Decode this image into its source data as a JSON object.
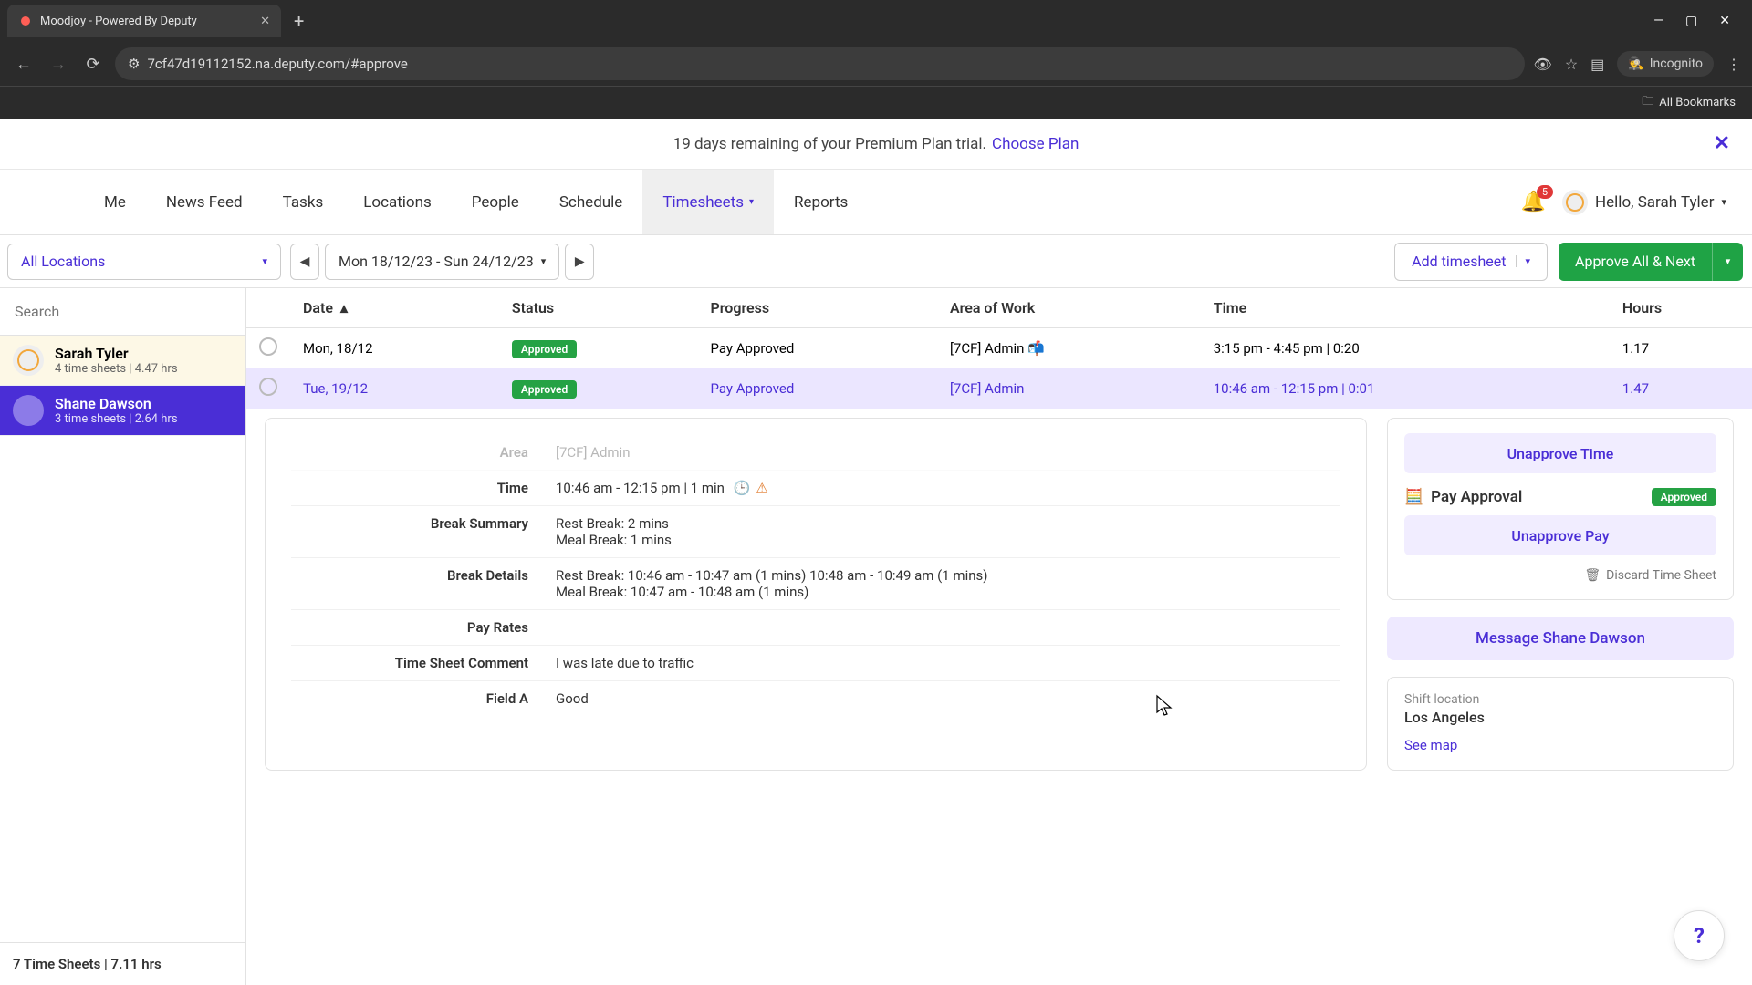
{
  "browser": {
    "tab_title": "Moodjoy - Powered By Deputy",
    "url": "7cf47d19112152.na.deputy.com/#approve",
    "incognito_label": "Incognito",
    "all_bookmarks": "All Bookmarks"
  },
  "banner": {
    "text": "19 days remaining of your Premium Plan trial.",
    "link": "Choose Plan"
  },
  "nav": {
    "items": [
      "Me",
      "News Feed",
      "Tasks",
      "Locations",
      "People",
      "Schedule",
      "Timesheets",
      "Reports"
    ],
    "active_index": 6,
    "notification_count": "5",
    "greeting": "Hello, Sarah Tyler"
  },
  "toolbar": {
    "location_filter": "All Locations",
    "date_range": "Mon 18/12/23 - Sun 24/12/23",
    "add_timesheet": "Add timesheet",
    "approve_all": "Approve All & Next"
  },
  "sidebar": {
    "search_placeholder": "Search",
    "employees": [
      {
        "name": "Sarah Tyler",
        "sub": "4 time sheets | 4.47 hrs",
        "selected": false
      },
      {
        "name": "Shane Dawson",
        "sub": "3 time sheets | 2.64 hrs",
        "selected": true
      }
    ],
    "footer": "7 Time Sheets | 7.11 hrs"
  },
  "table": {
    "headers": {
      "date": "Date",
      "status": "Status",
      "progress": "Progress",
      "area": "Area of Work",
      "time": "Time",
      "hours": "Hours"
    },
    "rows": [
      {
        "date": "Mon, 18/12",
        "status": "Approved",
        "progress": "Pay Approved",
        "area": "[7CF] Admin 📬",
        "time": "3:15 pm - 4:45 pm | 0:20",
        "hours": "1.17",
        "selected": false
      },
      {
        "date": "Tue, 19/12",
        "status": "Approved",
        "progress": "Pay Approved",
        "area": "[7CF] Admin",
        "time": "10:46 am - 12:15 pm | 0:01",
        "hours": "1.47",
        "selected": true
      }
    ]
  },
  "detail": {
    "area_label": "Area",
    "area_value": "[7CF] Admin",
    "time_label": "Time",
    "time_value": "10:46 am - 12:15 pm | 1 min",
    "break_summary_label": "Break Summary",
    "break_summary_value_1": "Rest Break: 2 mins",
    "break_summary_value_2": "Meal Break: 1 mins",
    "break_details_label": "Break Details",
    "break_details_value_1": "Rest Break: 10:46 am - 10:47 am (1 mins) 10:48 am - 10:49 am (1 mins)",
    "break_details_value_2": "Meal Break: 10:47 am - 10:48 am (1 mins)",
    "pay_rates_label": "Pay Rates",
    "comment_label": "Time Sheet Comment",
    "comment_value": "I was late due to traffic",
    "field_a_label": "Field A",
    "field_a_value": "Good"
  },
  "right_panel": {
    "unapprove_time": "Unapprove Time",
    "pay_approval_label": "Pay Approval",
    "pay_approval_status": "Approved",
    "unapprove_pay": "Unapprove Pay",
    "discard": "Discard Time Sheet",
    "message_btn": "Message Shane Dawson",
    "shift_location_label": "Shift location",
    "shift_location_value": "Los Angeles",
    "see_map": "See map"
  }
}
